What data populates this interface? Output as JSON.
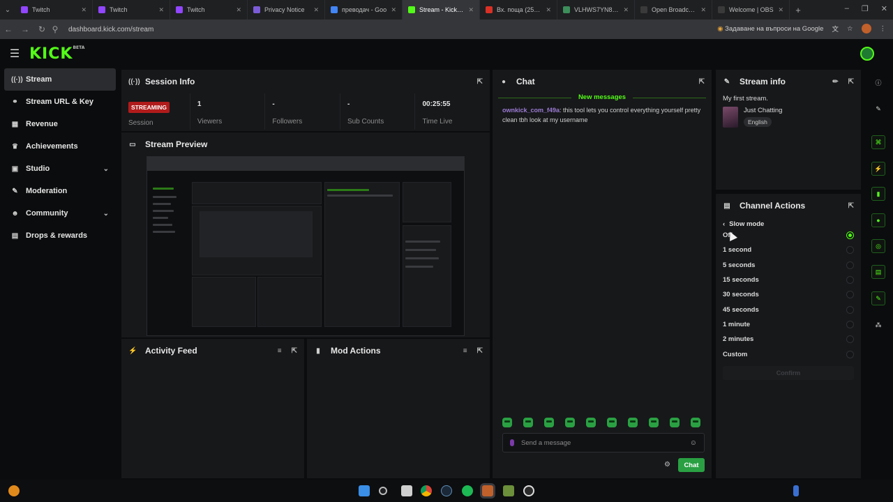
{
  "browser": {
    "tabs": [
      {
        "title": "Twitch",
        "color": "#9146ff",
        "active": false
      },
      {
        "title": "Twitch",
        "color": "#9146ff",
        "active": false
      },
      {
        "title": "Twitch",
        "color": "#9146ff",
        "active": false
      },
      {
        "title": "Privacy Notice",
        "color": "#7b5cd6",
        "active": false
      },
      {
        "title": "преводач - Goo",
        "color": "#4285f4",
        "active": false
      },
      {
        "title": "Stream - Kick Da",
        "color": "#53fc18",
        "active": true
      },
      {
        "title": "Вх. поща (258) -",
        "color": "#d93025",
        "active": false
      },
      {
        "title": "VLHWS7YN84/M",
        "color": "#3c8e5a",
        "active": false
      },
      {
        "title": "Open Broadcaste",
        "color": "#3a3a3a",
        "active": false
      },
      {
        "title": "Welcome | OBS",
        "color": "#3a3a3a",
        "active": false
      }
    ],
    "url": "dashboard.kick.com/stream",
    "ask_google": "Задаване на въпроси на Google"
  },
  "header": {
    "logo": "KICK",
    "logo_sup": "BETA"
  },
  "sidebar": {
    "items": [
      {
        "label": "Stream",
        "icon": "broadcast-icon",
        "glyph": "((·))",
        "active": true,
        "chevron": false
      },
      {
        "label": "Stream URL & Key",
        "icon": "link-icon",
        "glyph": "⚭",
        "active": false,
        "chevron": false
      },
      {
        "label": "Revenue",
        "icon": "chart-icon",
        "glyph": "▦",
        "active": false,
        "chevron": false
      },
      {
        "label": "Achievements",
        "icon": "trophy-icon",
        "glyph": "♛",
        "active": false,
        "chevron": false
      },
      {
        "label": "Studio",
        "icon": "film-icon",
        "glyph": "▣",
        "active": false,
        "chevron": true
      },
      {
        "label": "Moderation",
        "icon": "wrench-icon",
        "glyph": "✎",
        "active": false,
        "chevron": false
      },
      {
        "label": "Community",
        "icon": "users-icon",
        "glyph": "☻",
        "active": false,
        "chevron": true
      },
      {
        "label": "Drops & rewards",
        "icon": "gift-icon",
        "glyph": "▤",
        "active": false,
        "chevron": false
      }
    ]
  },
  "session": {
    "title": "Session Info",
    "status_badge": "STREAMING",
    "cells": [
      {
        "value": "1",
        "label": "Viewers"
      },
      {
        "value": "-",
        "label": "Followers"
      },
      {
        "value": "-",
        "label": "Sub Counts"
      },
      {
        "value": "00:25:55",
        "label": "Time Live"
      }
    ],
    "session_label": "Session"
  },
  "preview": {
    "title": "Stream Preview"
  },
  "activity": {
    "title": "Activity Feed"
  },
  "mod": {
    "title": "Mod Actions"
  },
  "chat": {
    "title": "Chat",
    "new_messages": "New messages",
    "messages": [
      {
        "user": "ownkick_com_f49a",
        "text": ": this tool lets you control everything yourself pretty clean tbh look at my username"
      }
    ],
    "placeholder": "Send a message",
    "send_label": "Chat"
  },
  "stream_info": {
    "title": "Stream info",
    "stream_title": "My first stream.",
    "category": "Just Chatting",
    "language": "English"
  },
  "channel_actions": {
    "title": "Channel Actions",
    "submenu": "Slow mode",
    "options": [
      {
        "label": "Off",
        "selected": true
      },
      {
        "label": "1 second",
        "selected": false
      },
      {
        "label": "5 seconds",
        "selected": false
      },
      {
        "label": "15 seconds",
        "selected": false
      },
      {
        "label": "30 seconds",
        "selected": false
      },
      {
        "label": "45 seconds",
        "selected": false
      },
      {
        "label": "1 minute",
        "selected": false
      },
      {
        "label": "2 minutes",
        "selected": false
      },
      {
        "label": "Custom",
        "selected": false
      }
    ],
    "confirm": "Confirm"
  },
  "colors": {
    "accent": "#53fc18",
    "live": "#b11b1b",
    "panel": "#17181a"
  }
}
